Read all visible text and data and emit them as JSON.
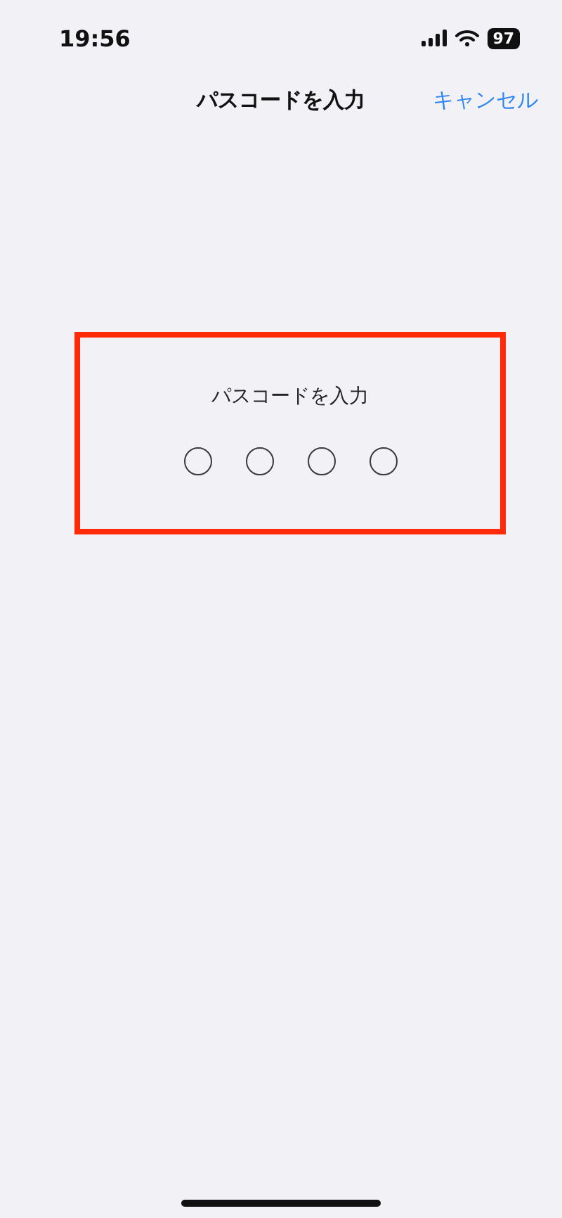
{
  "status_bar": {
    "time": "19:56",
    "battery": "97"
  },
  "nav": {
    "title": "パスコードを入力",
    "cancel": "キャンセル"
  },
  "passcode": {
    "prompt": "パスコードを入力",
    "highlighted": true,
    "digits": [
      {
        "filled": false
      },
      {
        "filled": false
      },
      {
        "filled": false
      },
      {
        "filled": false
      }
    ]
  }
}
